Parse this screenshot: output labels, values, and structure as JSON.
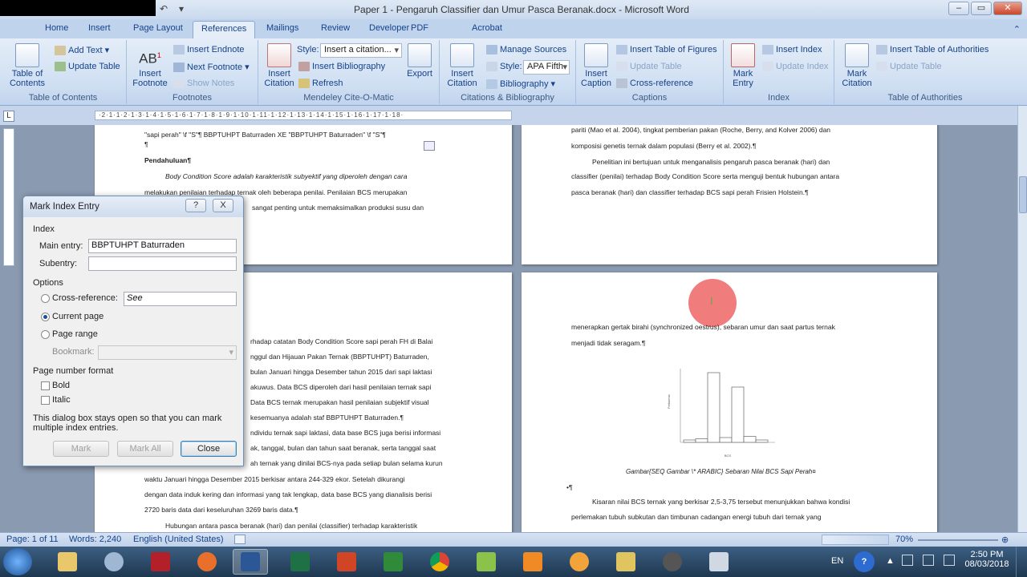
{
  "window": {
    "title": "Paper 1 - Pengaruh Classifier dan Umur Pasca Beranak.docx - Microsoft Word"
  },
  "ribbon_tabs": [
    "Home",
    "Insert",
    "Page Layout",
    "References",
    "Mailings",
    "Review",
    "Developer",
    "PDF",
    "Acrobat"
  ],
  "ribbon": {
    "toc": {
      "big": "Table of\nContents",
      "label1": "Table of",
      "label2": "Contents",
      "add_text": "Add Text",
      "update_table": "Update Table",
      "group": "Table of Contents"
    },
    "footnotes": {
      "big1": "Insert",
      "big2": "Footnote",
      "endnote": "Insert Endnote",
      "next": "Next Footnote",
      "show": "Show Notes",
      "ab": "AB",
      "sup": "1",
      "group": "Footnotes"
    },
    "mendeley": {
      "big1": "Insert",
      "big2": "Citation",
      "style_label": "Style:",
      "style_value": "Insert a citation...",
      "insert_bib": "Insert Bibliography",
      "refresh": "Refresh",
      "export": "Export",
      "group": "Mendeley Cite-O-Matic"
    },
    "citations": {
      "big1": "Insert",
      "big2": "Citation",
      "manage": "Manage Sources",
      "style_label": "Style:",
      "style_value": "APA Fifth",
      "bibliography": "Bibliography",
      "group": "Citations & Bibliography"
    },
    "captions": {
      "big1": "Insert",
      "big2": "Caption",
      "tof": "Insert Table of Figures",
      "update": "Update Table",
      "xref": "Cross-reference",
      "group": "Captions"
    },
    "index": {
      "big1": "Mark",
      "big2": "Entry",
      "insert": "Insert Index",
      "update": "Update Index",
      "group": "Index"
    },
    "toa": {
      "big1": "Mark",
      "big2": "Citation",
      "insert": "Insert Table of Authorities",
      "update": "Update Table",
      "group": "Table of Authorities"
    }
  },
  "ruler_text": "·2·1·1·2·1·3·1·4·1·5·1·6·1·7·1·8·1·9·1·10·1·11·1·12·1·13·1·14·1·15·1·16·1·17·1·18·",
  "page1_lines": [
    "\"sapi perah\" \\f \"S\"¶ BBPTUHPT Baturraden XE \"BBPTUHPT Baturraden\" \\f \"S\"¶",
    "¶",
    "Pendahuluan¶",
    "Body Condition Score adalah karakteristik subyektif yang diperoleh dengan cara",
    "melakukan penilaian terhadap ternak oleh beberapa penilai. Penilaian BCS merupakan",
    "sangat penting untuk memaksimalkan produksi susu dan"
  ],
  "page2_lines": [
    "pariti (Mao et al. 2004), tingkat pemberian pakan (Roche, Berry, and Kolver 2006) dan",
    "komposisi genetis ternak dalam populasi (Berry et al. 2002).¶",
    "Penelitian ini bertujuan untuk menganalisis pengaruh pasca beranak (hari) dan",
    "classifier (penilai) terhadap Body Condition Score serta menguji bentuk hubungan antara",
    "pasca beranak (hari) dan classifier terhadap BCS sapi perah Frisien Holstein.¶"
  ],
  "page3_lines": [
    "rhadap catatan Body Condition Score sapi perah FH di Balai",
    "nggul dan Hijauan Pakan Ternak (BBPTUHPT) Baturraden,",
    "bulan Januari hingga Desember tahun 2015 dari sapi laktasi",
    "akuwus. Data BCS diperoleh dari hasil penilaian ternak sapi",
    "Data BCS ternak merupakan hasil penilaian subjektif visual",
    "kesemuanya adalah staf BBPTUHPT Baturraden.¶",
    "ndividu ternak sapi laktasi, data base BCS juga berisi informasi",
    "ak, tanggal, bulan dan tahun saat beranak, serta tanggal saat",
    "ah ternak yang dinilai BCS-nya pada setiap bulan selama kurun",
    "waktu Januari hingga Desember 2015 berkisar antara 244-329 ekor. Setelah dikurangi",
    "dengan data induk kering dan informasi yang tak lengkap, data base BCS yang dianalisis berisi",
    "2720 baris data dari keseluruhan 3269 baris data.¶",
    "Hubungan antara pasca beranak (hari) dan penilai (classifier) terhadap karakteristik"
  ],
  "page4_lines": [
    "menerapkan gertak birahi (synchronized oestrus), sebaran umur dan saat partus ternak",
    "menjadi tidak seragam.¶",
    "Gambar{SEQ Gambar \\* ARABIC} Sebaran Nilai BCS Sapi Perah¤",
    "•¶",
    "Kisaran nilai BCS ternak yang berkisar 2,5-3,75 tersebut menunjukkan bahwa kondisi",
    "perlemakan tubuh subkutan dan timbunan cadangan energi tubuh dari ternak yang"
  ],
  "figure": {
    "chart_data": {
      "type": "bar",
      "title": "",
      "xlabel": "BCS",
      "ylabel": "Frekuensi",
      "values": [
        2,
        3,
        58,
        4,
        46,
        5,
        2
      ]
    }
  },
  "dialog": {
    "title": "Mark Index Entry",
    "help": "?",
    "close_x": "X",
    "index_section": "Index",
    "main_entry_label": "Main entry:",
    "main_entry_value": "BBPTUHPT Baturraden",
    "subentry_label": "Subentry:",
    "subentry_value": "",
    "options_section": "Options",
    "cross_ref_label": "Cross-reference:",
    "cross_ref_value": "See",
    "current_page_label": "Current page",
    "page_range_label": "Page range",
    "bookmark_label": "Bookmark:",
    "page_format_section": "Page number format",
    "bold_label": "Bold",
    "italic_label": "Italic",
    "note": "This dialog box stays open so that you can mark multiple index entries.",
    "mark_btn": "Mark",
    "mark_all_btn": "Mark All",
    "close_btn": "Close",
    "selected_option": "Current page"
  },
  "statusbar": {
    "page": "Page: 1 of 11",
    "words": "Words: 2,240",
    "language": "English (United States)",
    "zoom": "70%"
  },
  "taskbar": {
    "lang": "EN",
    "time": "2:50 PM",
    "date": "08/03/2018"
  }
}
